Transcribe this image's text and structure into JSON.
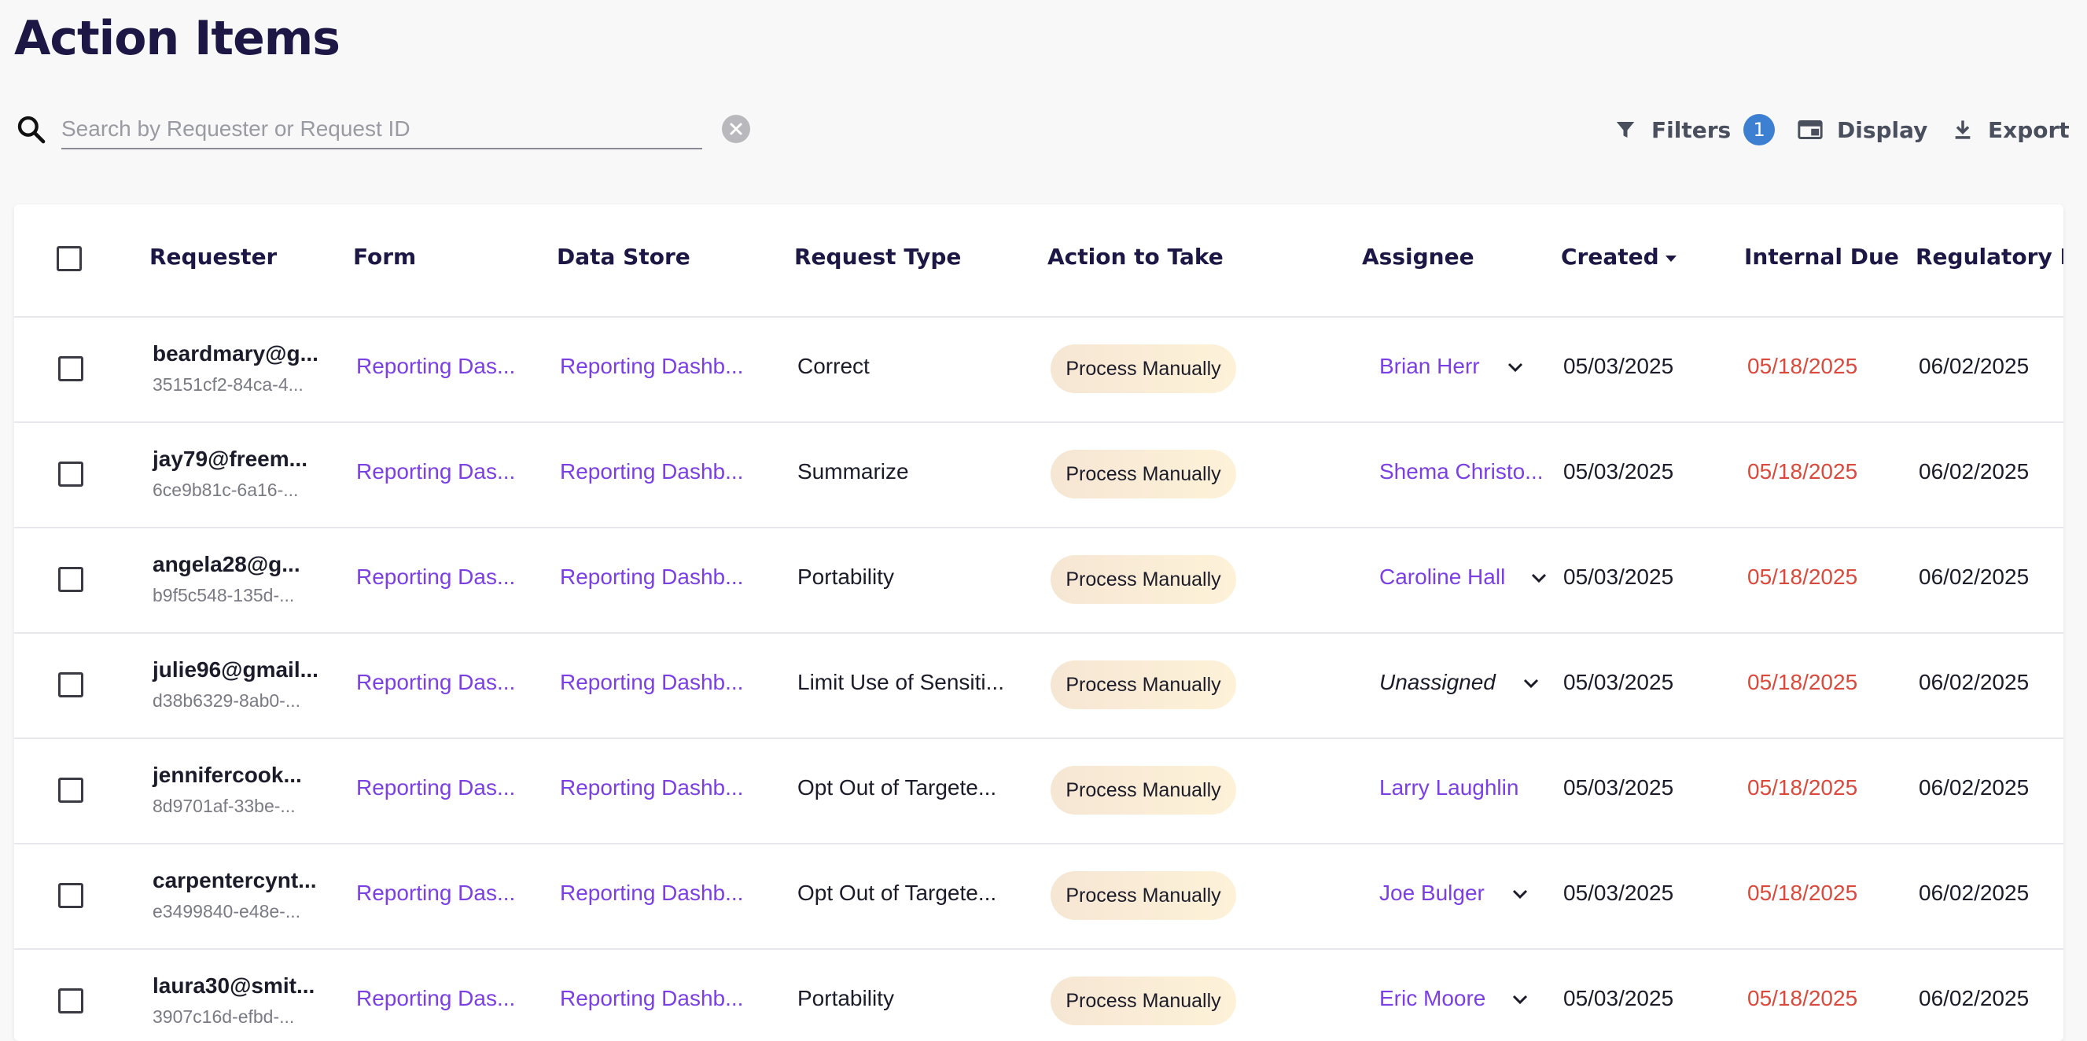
{
  "page_title": "Action Items",
  "search": {
    "placeholder": "Search by Requester or Request ID",
    "value": ""
  },
  "toolbar": {
    "filters_label": "Filters",
    "filters_count": "1",
    "display_label": "Display",
    "export_label": "Export"
  },
  "colors": {
    "accent": "#7b3fe4",
    "overdue": "#d94a3c",
    "badge": "#3d7fd0",
    "title": "#1c1745"
  },
  "table": {
    "headers": {
      "requester": "Requester",
      "form": "Form",
      "data_store": "Data Store",
      "request_type": "Request Type",
      "action": "Action to Take",
      "assignee": "Assignee",
      "created": "Created",
      "internal_due": "Internal Due D",
      "regulatory_due": "Regulatory Du"
    },
    "rows": [
      {
        "email": "beardmary@g...",
        "id": "35151cf2-84ca-4...",
        "form": "Reporting Das...",
        "data_store": "Reporting Dashb...",
        "request_type": "Correct",
        "action": "Process Manually",
        "assignee": "Brian Herr",
        "created": "05/03/2025",
        "internal_due": "05/18/2025",
        "regulatory_due": "06/02/2025"
      },
      {
        "email": "jay79@freem...",
        "id": "6ce9b81c-6a16-...",
        "form": "Reporting Das...",
        "data_store": "Reporting Dashb...",
        "request_type": "Summarize",
        "action": "Process Manually",
        "assignee": "Shema Christo...",
        "created": "05/03/2025",
        "internal_due": "05/18/2025",
        "regulatory_due": "06/02/2025"
      },
      {
        "email": "angela28@g...",
        "id": "b9f5c548-135d-...",
        "form": "Reporting Das...",
        "data_store": "Reporting Dashb...",
        "request_type": "Portability",
        "action": "Process Manually",
        "assignee": "Caroline Hall",
        "created": "05/03/2025",
        "internal_due": "05/18/2025",
        "regulatory_due": "06/02/2025"
      },
      {
        "email": "julie96@gmail...",
        "id": "d38b6329-8ab0-...",
        "form": "Reporting Das...",
        "data_store": "Reporting Dashb...",
        "request_type": "Limit Use of Sensiti...",
        "action": "Process Manually",
        "assignee": "Unassigned",
        "created": "05/03/2025",
        "internal_due": "05/18/2025",
        "regulatory_due": "06/02/2025"
      },
      {
        "email": "jennifercook...",
        "id": "8d9701af-33be-...",
        "form": "Reporting Das...",
        "data_store": "Reporting Dashb...",
        "request_type": "Opt Out of Targete...",
        "action": "Process Manually",
        "assignee": "Larry Laughlin",
        "created": "05/03/2025",
        "internal_due": "05/18/2025",
        "regulatory_due": "06/02/2025"
      },
      {
        "email": "carpentercynt...",
        "id": "e3499840-e48e-...",
        "form": "Reporting Das...",
        "data_store": "Reporting Dashb...",
        "request_type": "Opt Out of Targete...",
        "action": "Process Manually",
        "assignee": "Joe Bulger",
        "created": "05/03/2025",
        "internal_due": "05/18/2025",
        "regulatory_due": "06/02/2025"
      },
      {
        "email": "laura30@smit...",
        "id": "3907c16d-efbd-...",
        "form": "Reporting Das...",
        "data_store": "Reporting Dashb...",
        "request_type": "Portability",
        "action": "Process Manually",
        "assignee": "Eric Moore",
        "created": "05/03/2025",
        "internal_due": "05/18/2025",
        "regulatory_due": "06/02/2025"
      }
    ]
  }
}
